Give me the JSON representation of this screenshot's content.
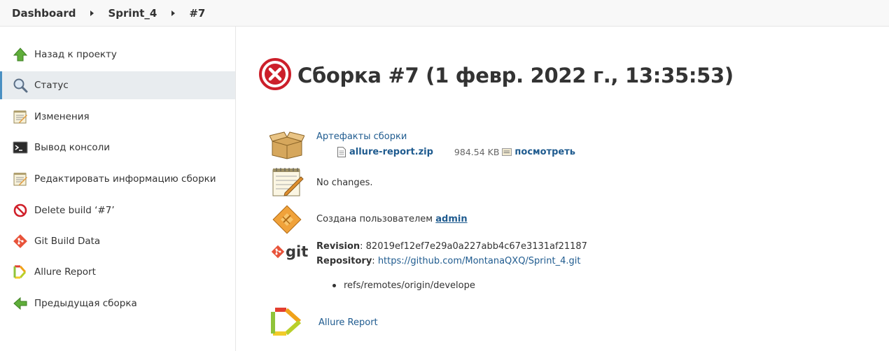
{
  "breadcrumbs": [
    {
      "label": "Dashboard"
    },
    {
      "label": "Sprint_4"
    },
    {
      "label": "#7"
    }
  ],
  "sidebar": {
    "items": [
      {
        "label": "Назад к проекту",
        "icon": "up-arrow-icon"
      },
      {
        "label": "Статус",
        "icon": "magnifier-icon",
        "active": true
      },
      {
        "label": "Изменения",
        "icon": "notepad-icon"
      },
      {
        "label": "Вывод консоли",
        "icon": "terminal-icon"
      },
      {
        "label": "Редактировать информацию сборки",
        "icon": "notepad-edit-icon"
      },
      {
        "label": "Delete build ‘#7’",
        "icon": "no-entry-icon"
      },
      {
        "label": "Git Build Data",
        "icon": "git-icon"
      },
      {
        "label": "Allure Report",
        "icon": "allure-icon"
      },
      {
        "label": "Предыдущая сборка",
        "icon": "left-arrow-icon"
      }
    ]
  },
  "build": {
    "title": "Сборка #7 (1 февр. 2022 г., 13:35:53)",
    "status_icon": "failed-icon",
    "status_color": "#cc1f2a"
  },
  "artifacts": {
    "heading": "Артефакты сборки",
    "file_name": "allure-report.zip",
    "file_size": "984.54 KB",
    "view_label": "посмотреть"
  },
  "changes": {
    "text": "No changes."
  },
  "cause": {
    "prefix": "Создана пользователем",
    "user": "admin"
  },
  "git": {
    "logo_text": "git",
    "revision_label": "Revision",
    "revision_value": ": 82019ef12ef7e29a0a227abb4c67e3131af21187",
    "repository_label": "Repository",
    "repository_sep": ": ",
    "repository_url": "https://github.com/MontanaQXQ/Sprint_4.git",
    "branches": [
      "refs/remotes/origin/develope"
    ]
  },
  "allure": {
    "label": "Allure Report"
  },
  "colors": {
    "link": "#1f5b8f",
    "active_bg": "#e8ecef",
    "accent": "#4a90c2"
  }
}
